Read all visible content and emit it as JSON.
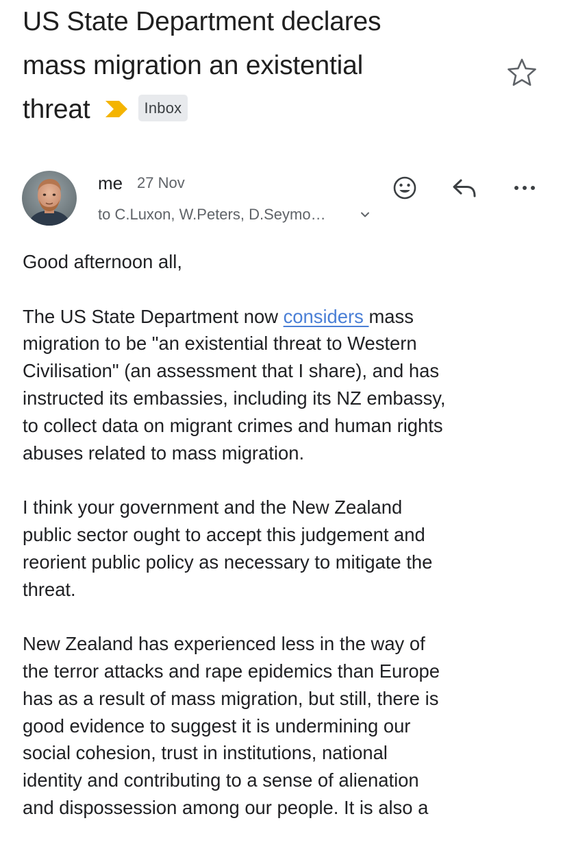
{
  "email": {
    "subject_lines": [
      "US State Department declares",
      "mass migration an existential",
      "threat"
    ],
    "label": "Inbox",
    "sender": "me",
    "date": "27 Nov",
    "recipients": "to C.Luxon, W.Peters, D.Seymo…"
  },
  "body": {
    "greeting": "Good afternoon all,",
    "p1_before_link": "The US State Department now ",
    "p1_link": "considers ",
    "p1_after_link": "mass\nmigration to be \"an existential threat to Western\nCivilisation\" (an assessment that I share), and has\ninstructed its embassies, including its NZ embassy,\nto collect data on migrant crimes and human rights\nabuses related to mass migration.",
    "p2": "I think your government and the New Zealand\npublic sector ought to accept this judgement and\nreorient public policy as necessary to mitigate the\nthreat.",
    "p3": "New Zealand has experienced less in the way of\nthe terror attacks and rape epidemics than Europe\nhas as a result of mass migration, but still, there is\ngood evidence to suggest it is undermining our\nsocial cohesion, trust in institutions, national\nidentity and contributing to a sense of alienation\nand dispossession among our people. It is also a"
  },
  "icons": {
    "importance": "importance-marker-icon",
    "star": "star-icon",
    "emoji": "emoji-reaction-icon",
    "reply": "reply-icon",
    "more": "more-options-icon",
    "chevron": "chevron-down-icon"
  },
  "colors": {
    "importance": "#f4b400",
    "link": "#4a7fd6",
    "chip_bg": "#e8eaed"
  }
}
